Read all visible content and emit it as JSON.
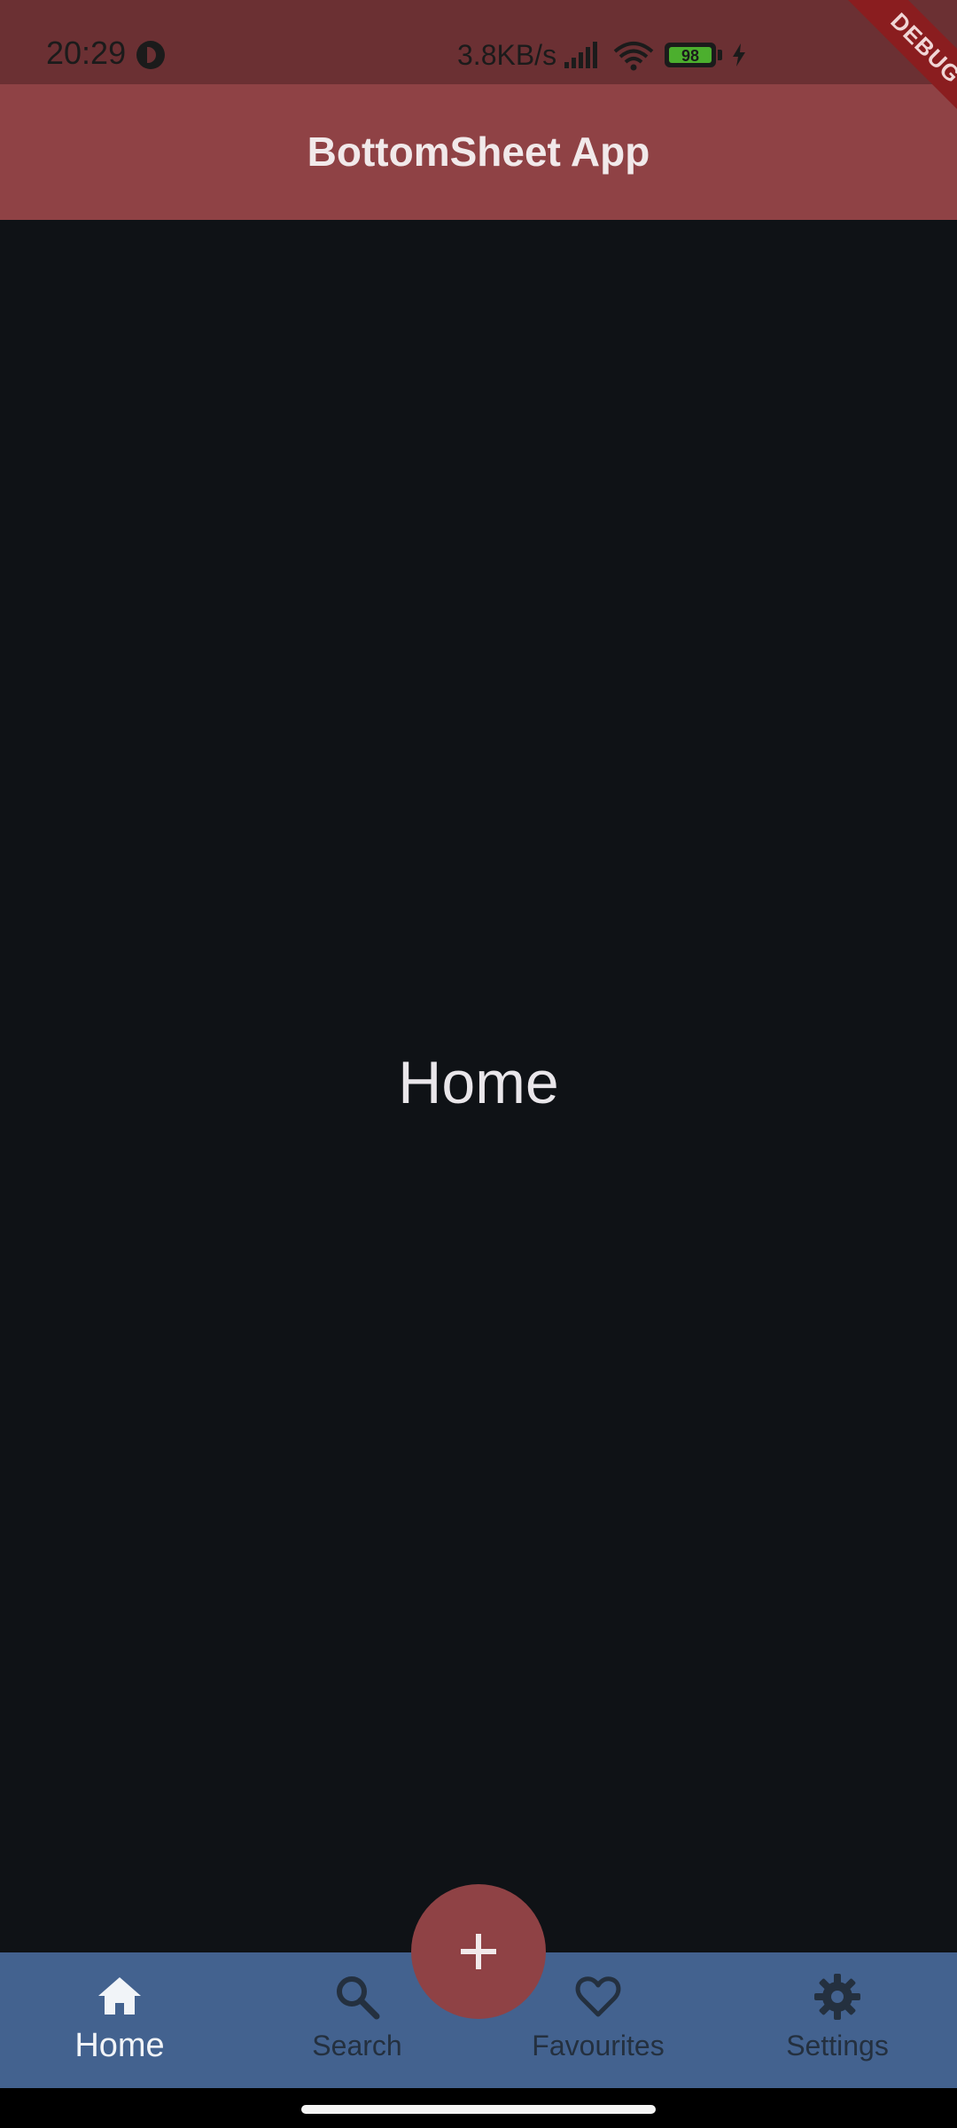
{
  "status_bar": {
    "time": "20:29",
    "net_speed": "3.8KB/s",
    "battery_level": "98",
    "icons": [
      "privacy-dot-icon",
      "signal-icon",
      "wifi-icon",
      "battery-icon",
      "charging-icon"
    ]
  },
  "debug_banner": "DEBUG",
  "app_bar": {
    "title": "BottomSheet App"
  },
  "body": {
    "label": "Home"
  },
  "bottom_nav": {
    "items": [
      {
        "label": "Home",
        "icon": "home-icon",
        "active": true
      },
      {
        "label": "Search",
        "icon": "search-icon",
        "active": false
      },
      {
        "label": "Favourites",
        "icon": "heart-icon",
        "active": false
      },
      {
        "label": "Settings",
        "icon": "gear-icon",
        "active": false
      }
    ]
  },
  "fab": {
    "icon": "add-icon"
  },
  "colors": {
    "status_bar": "#6b3033",
    "app_bar": "#8f4245",
    "background": "#0f1216",
    "bottom_nav": "#43628f",
    "fab": "#8f4245",
    "debug_banner": "#8a1d1f"
  }
}
